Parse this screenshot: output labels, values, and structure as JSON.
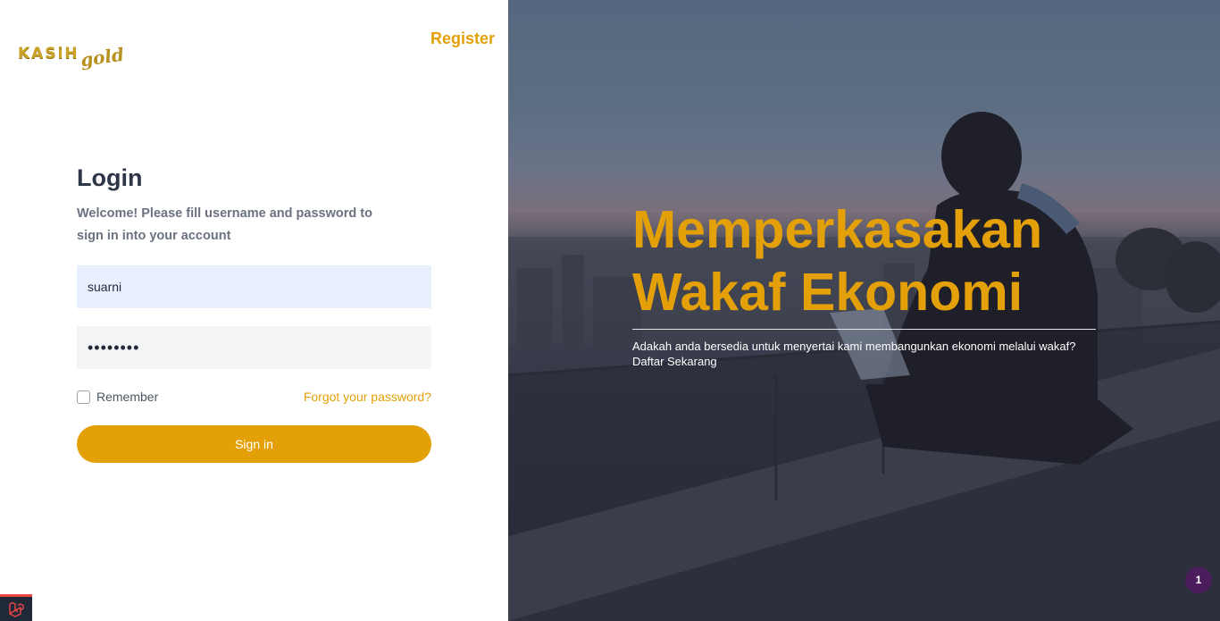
{
  "brand": {
    "logo_main": "KASiH",
    "logo_script": "gold",
    "color": "#e3a008"
  },
  "header": {
    "register_label": "Register"
  },
  "login": {
    "title": "Login",
    "welcome": "Welcome! Please fill username and password to sign in into your account",
    "username": {
      "value": "suarni"
    },
    "password": {
      "value": "••••••••"
    },
    "remember_label": "Remember",
    "remember_checked": false,
    "forgot_label": "Forgot your password?",
    "signin_label": "Sign in"
  },
  "hero": {
    "title_line1": "Memperkasakan",
    "title_line2": "Wakaf Ekonomi",
    "subtitle": "Adakah anda bersedia untuk menyertai kami membangunkan ekonomi melalui wakaf?",
    "cta": "Daftar Sekarang"
  },
  "notification": {
    "count": "1"
  },
  "icons": {
    "framework_badge": "laravel-icon"
  }
}
